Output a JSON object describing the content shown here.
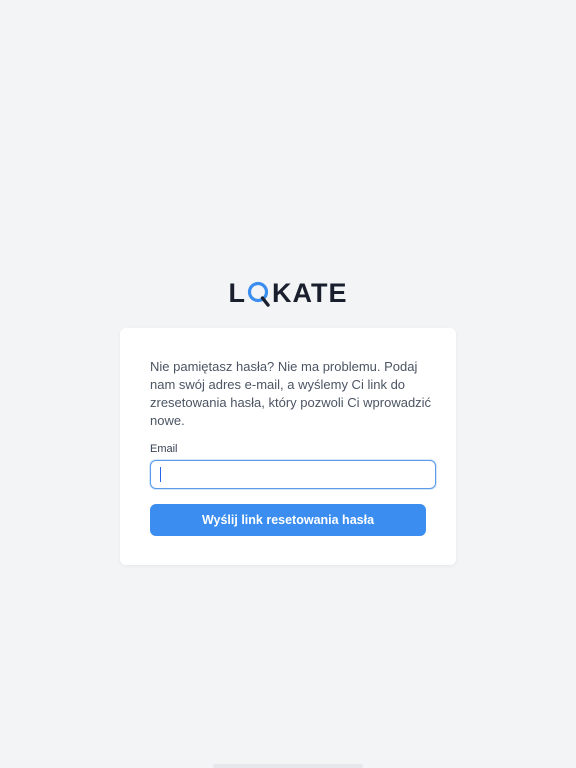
{
  "brand": {
    "logo_text_left": "L",
    "logo_text_right": "KATE",
    "logo_accent_color": "#3b8ef0",
    "logo_dark_color": "#1a1f2e"
  },
  "reset_form": {
    "intro_text": "Nie pamiętasz hasła? Nie ma problemu. Podaj nam swój adres e-mail, a wyślemy Ci link do zresetowania hasła, który pozwoli Ci wprowadzić nowe.",
    "email_label": "Email",
    "email_value": "",
    "submit_label": "Wyślij link resetowania hasła"
  },
  "colors": {
    "background": "#f3f4f6",
    "card": "#ffffff",
    "primary": "#3b8ef0",
    "input_focus_border": "#5b9be8"
  }
}
